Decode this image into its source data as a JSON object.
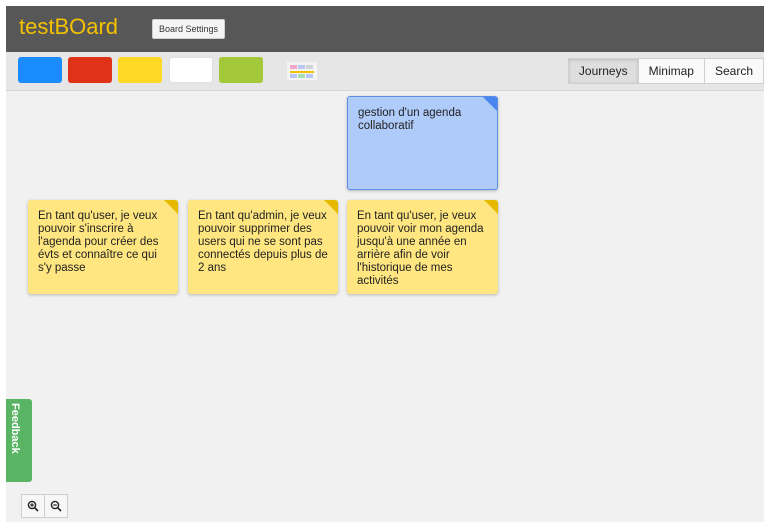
{
  "app": {
    "title": "testBOard",
    "settings_label": "Board Settings"
  },
  "toolbar": {
    "colors": [
      {
        "name": "blue",
        "hex": "#1a8cff"
      },
      {
        "name": "red",
        "hex": "#e03216"
      },
      {
        "name": "yellow",
        "hex": "#ffd925"
      },
      {
        "name": "white",
        "hex": "#ffffff"
      },
      {
        "name": "green",
        "hex": "#a3c93a"
      }
    ],
    "layout_icon": "color-grid-icon",
    "tabs": [
      {
        "label": "Journeys",
        "active": true
      },
      {
        "label": "Minimap",
        "active": false
      },
      {
        "label": "Search",
        "active": false
      }
    ]
  },
  "cards": [
    {
      "color": "#aecbfa",
      "text": "gestion d'un agenda collaboratif"
    },
    {
      "color": "#ffe680",
      "text": "En tant qu'user, je veux pouvoir s'inscrire à l'agenda pour créer des évts et connaître ce qui s'y passe"
    },
    {
      "color": "#ffe680",
      "text": "En tant qu'admin, je veux pouvoir supprimer des users qui ne se sont pas connectés depuis plus de 2 ans"
    },
    {
      "color": "#ffe680",
      "text": "En tant qu'user, je veux pouvoir voir mon agenda jusqu'à une année en arrière afin de voir l'historique de mes activités"
    }
  ],
  "feedback": {
    "label": "Feedback"
  },
  "zoom": {
    "in_icon": "zoom-in-icon",
    "out_icon": "zoom-out-icon"
  }
}
